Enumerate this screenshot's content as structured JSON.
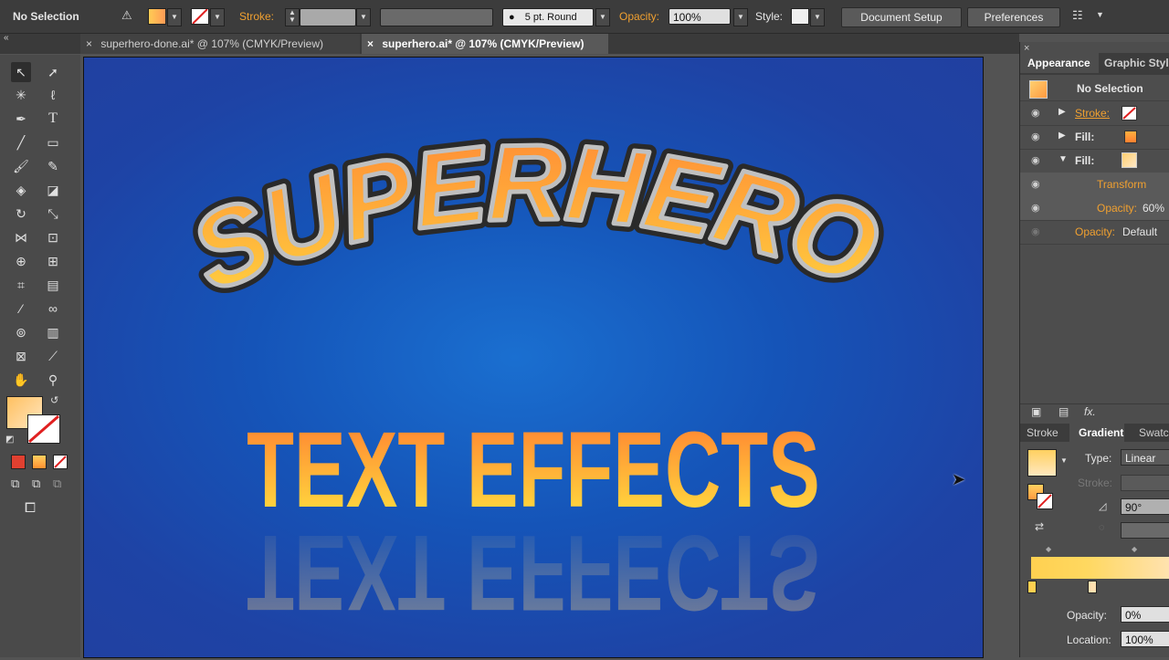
{
  "control_bar": {
    "selection_label": "No Selection",
    "stroke_label": "Stroke:",
    "brush_value": "5 pt. Round",
    "opacity_label": "Opacity:",
    "opacity_value": "100%",
    "style_label": "Style:",
    "document_setup": "Document Setup",
    "preferences": "Preferences"
  },
  "tabs": [
    {
      "label": "superhero-done.ai* @ 107% (CMYK/Preview)",
      "close": "×"
    },
    {
      "label": "superhero.ai* @ 107% (CMYK/Preview)",
      "close": "×"
    }
  ],
  "artwork": {
    "headline": "SUPERHERO",
    "subhead": "TEXT EFFECTS"
  },
  "appearance_panel": {
    "tabs": [
      "Appearance",
      "Graphic Styl"
    ],
    "title": "No Selection",
    "rows": [
      {
        "label": "Stroke:",
        "expand": "▶"
      },
      {
        "label": "Fill:",
        "expand": "▶"
      },
      {
        "label": "Fill:",
        "expand": "▼"
      },
      {
        "label": "Transform"
      },
      {
        "label": "Opacity:",
        "value": "60%"
      },
      {
        "label": "Opacity:",
        "value": "Default"
      }
    ],
    "footer_fx": "fx."
  },
  "gradient_panel": {
    "tabs": [
      "Stroke",
      "Gradient",
      "Swatc"
    ],
    "type_label": "Type:",
    "type_value": "Linear",
    "stroke_label": "Stroke:",
    "angle_value": "90°",
    "opacity_label": "Opacity:",
    "opacity_value": "0%",
    "location_label": "Location:",
    "location_value": "100%"
  },
  "colors": {
    "accent": "#f0a030",
    "artboard_blue": "#1554b8",
    "gradient_start": "#ffcc44",
    "gradient_end": "#ff7a2a"
  }
}
